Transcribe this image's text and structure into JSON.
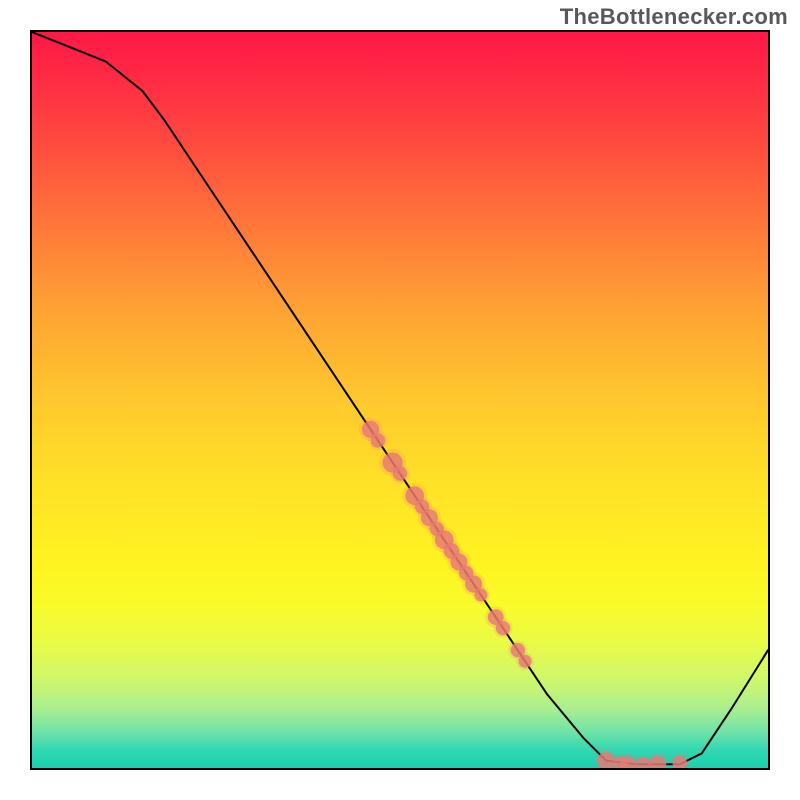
{
  "source_label": "TheBottlenecker.com",
  "colors": {
    "gradient_top": "#ff1846",
    "gradient_mid": "#ffe327",
    "gradient_bottom": "#19d0b0",
    "curve": "#000000",
    "points": "#e87a74"
  },
  "chart_data": {
    "type": "line",
    "title": "",
    "xlabel": "",
    "ylabel": "",
    "xlim": [
      0,
      100
    ],
    "ylim": [
      0,
      100
    ],
    "curve": [
      {
        "x": 0,
        "y": 100
      },
      {
        "x": 5,
        "y": 98
      },
      {
        "x": 10,
        "y": 96
      },
      {
        "x": 15,
        "y": 92
      },
      {
        "x": 18,
        "y": 88
      },
      {
        "x": 22,
        "y": 82
      },
      {
        "x": 30,
        "y": 70
      },
      {
        "x": 40,
        "y": 55
      },
      {
        "x": 50,
        "y": 40
      },
      {
        "x": 60,
        "y": 25
      },
      {
        "x": 70,
        "y": 10
      },
      {
        "x": 75,
        "y": 4
      },
      {
        "x": 78,
        "y": 1
      },
      {
        "x": 82,
        "y": 0.5
      },
      {
        "x": 88,
        "y": 0.5
      },
      {
        "x": 91,
        "y": 2
      },
      {
        "x": 95,
        "y": 8
      },
      {
        "x": 100,
        "y": 16
      }
    ],
    "points_on_curve": [
      {
        "x": 46,
        "y": 46,
        "r": 1.2
      },
      {
        "x": 47,
        "y": 44.5,
        "r": 1.0
      },
      {
        "x": 49,
        "y": 41.5,
        "r": 1.4
      },
      {
        "x": 50,
        "y": 40,
        "r": 1.0
      },
      {
        "x": 52,
        "y": 37,
        "r": 1.3
      },
      {
        "x": 53,
        "y": 35.5,
        "r": 1.0
      },
      {
        "x": 54,
        "y": 34,
        "r": 1.2
      },
      {
        "x": 55,
        "y": 32.5,
        "r": 1.0
      },
      {
        "x": 56,
        "y": 31,
        "r": 1.3
      },
      {
        "x": 57,
        "y": 29.5,
        "r": 1.1
      },
      {
        "x": 58,
        "y": 28,
        "r": 1.2
      },
      {
        "x": 59,
        "y": 26.5,
        "r": 1.0
      },
      {
        "x": 60,
        "y": 25,
        "r": 1.2
      },
      {
        "x": 61,
        "y": 23.5,
        "r": 0.9
      },
      {
        "x": 63,
        "y": 20.5,
        "r": 1.1
      },
      {
        "x": 64,
        "y": 19,
        "r": 1.0
      },
      {
        "x": 66,
        "y": 16,
        "r": 1.0
      },
      {
        "x": 67,
        "y": 14.5,
        "r": 0.9
      },
      {
        "x": 78,
        "y": 1.0,
        "r": 1.2
      },
      {
        "x": 80,
        "y": 0.6,
        "r": 1.0
      },
      {
        "x": 81,
        "y": 0.5,
        "r": 1.1
      },
      {
        "x": 83,
        "y": 0.5,
        "r": 1.0
      },
      {
        "x": 85,
        "y": 0.5,
        "r": 1.2
      },
      {
        "x": 88,
        "y": 0.7,
        "r": 1.0
      }
    ]
  }
}
